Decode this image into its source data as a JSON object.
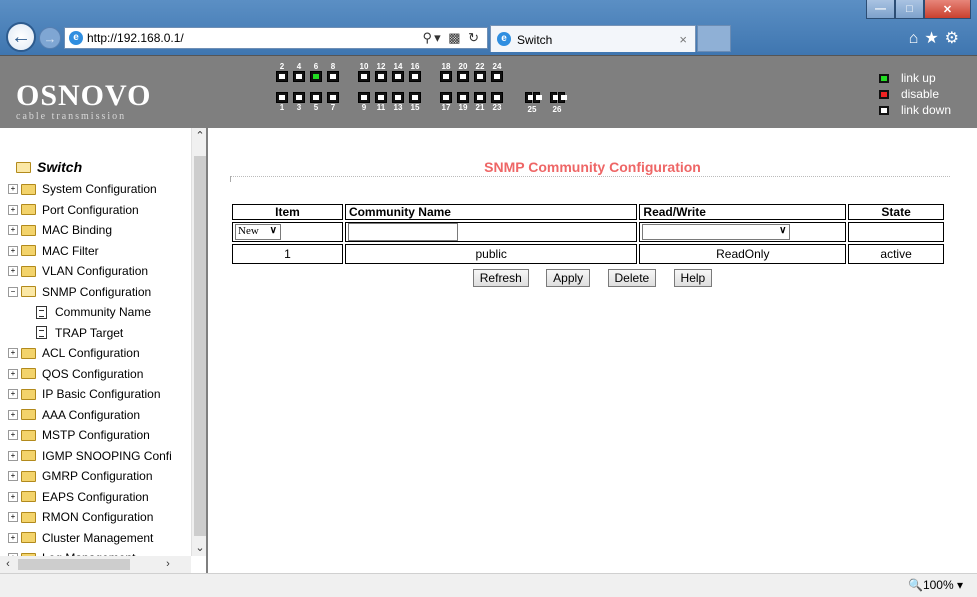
{
  "browser": {
    "url": "http://192.168.0.1/",
    "tab_title": "Switch",
    "tab_close": "×",
    "zoom": "100%"
  },
  "header": {
    "brand": "OSNOVO",
    "tagline": "cable transmission",
    "ports_top": [
      "2",
      "4",
      "6",
      "8",
      "10",
      "12",
      "14",
      "16",
      "18",
      "20",
      "22",
      "24"
    ],
    "ports_bottom": [
      "1",
      "3",
      "5",
      "7",
      "9",
      "11",
      "13",
      "15",
      "17",
      "19",
      "21",
      "23"
    ],
    "ports_extra": [
      "25",
      "26"
    ],
    "ports_up": [
      "6"
    ],
    "legend": {
      "up": "link up",
      "disable": "disable",
      "down": "link down"
    },
    "colors": {
      "up": "#22dd22",
      "disable": "#ee2222",
      "down": "#ffffff"
    }
  },
  "sidebar": {
    "root": "Switch",
    "items": [
      {
        "label": "System Configuration",
        "type": "folder"
      },
      {
        "label": "Port Configuration",
        "type": "folder"
      },
      {
        "label": "MAC Binding",
        "type": "folder"
      },
      {
        "label": "MAC Filter",
        "type": "folder"
      },
      {
        "label": "VLAN Configuration",
        "type": "folder"
      },
      {
        "label": "SNMP Configuration",
        "type": "folder-open"
      },
      {
        "label": "Community Name",
        "type": "page"
      },
      {
        "label": "TRAP Target",
        "type": "page"
      },
      {
        "label": "ACL Configuration",
        "type": "folder"
      },
      {
        "label": "QOS Configuration",
        "type": "folder"
      },
      {
        "label": "IP Basic Configuration",
        "type": "folder"
      },
      {
        "label": "AAA Configuration",
        "type": "folder"
      },
      {
        "label": "MSTP Configuration",
        "type": "folder"
      },
      {
        "label": "IGMP SNOOPING Confi",
        "type": "folder"
      },
      {
        "label": "GMRP Configuration",
        "type": "folder"
      },
      {
        "label": "EAPS Configuration",
        "type": "folder"
      },
      {
        "label": "RMON Configuration",
        "type": "folder"
      },
      {
        "label": "Cluster Management",
        "type": "folder"
      },
      {
        "label": "Log Management",
        "type": "folder"
      }
    ]
  },
  "main": {
    "title": "SNMP Community Configuration",
    "columns": [
      "Item",
      "Community Name",
      "Read/Write",
      "State"
    ],
    "new_row": {
      "item_select": "New",
      "community_name": "",
      "read_write": "",
      "state": ""
    },
    "rows": [
      {
        "item": "1",
        "community_name": "public",
        "read_write": "ReadOnly",
        "state": "active"
      }
    ],
    "buttons": {
      "refresh": "Refresh",
      "apply": "Apply",
      "delete": "Delete",
      "help": "Help"
    },
    "accent_color": "#ee6666"
  }
}
